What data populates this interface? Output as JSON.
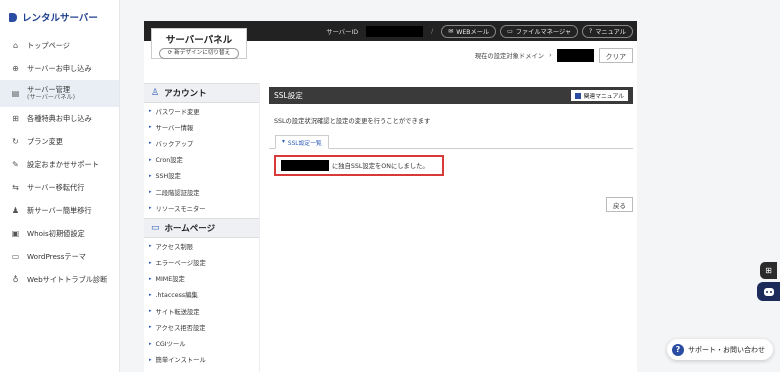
{
  "sidebar": {
    "logo": "レンタルサーバー",
    "items": [
      {
        "icon": "home-icon",
        "glyph": "⌂",
        "label": "トップページ"
      },
      {
        "icon": "plus-circle-icon",
        "glyph": "⊕",
        "label": "サーバーお申し込み"
      },
      {
        "icon": "server-icon",
        "glyph": "▤",
        "label": "サーバー管理",
        "sub": "(サーバーパネル)",
        "active": true
      },
      {
        "icon": "gift-icon",
        "glyph": "⊞",
        "label": "各種特典お申し込み"
      },
      {
        "icon": "refresh-icon",
        "glyph": "↻",
        "label": "プラン変更"
      },
      {
        "icon": "wrench-icon",
        "glyph": "✎",
        "label": "設定おまかせサポート"
      },
      {
        "icon": "migrate-icon",
        "glyph": "⇆",
        "label": "サーバー移転代行"
      },
      {
        "icon": "user-move-icon",
        "glyph": "♟",
        "label": "新サーバー簡単移行"
      },
      {
        "icon": "whois-icon",
        "glyph": "▣",
        "label": "Whois初期値設定"
      },
      {
        "icon": "wordpress-icon",
        "glyph": "▭",
        "label": "WordPressテーマ"
      },
      {
        "icon": "stethoscope-icon",
        "glyph": "♁",
        "label": "Webサイトトラブル診断"
      }
    ]
  },
  "topbar": {
    "server_id_label": "サーバーID",
    "sep": "/",
    "buttons": [
      {
        "icon": "mail-icon",
        "glyph": "✉",
        "label": "WEBメール"
      },
      {
        "icon": "folder-icon",
        "glyph": "▭",
        "label": "ファイルマネージャ"
      },
      {
        "icon": "help-icon",
        "glyph": "?",
        "label": "マニュアル"
      }
    ]
  },
  "panel": {
    "title": "サーバーパネル",
    "switch_label": "新デザインに切り替え",
    "domain_label": "現在の設定対象ドメイン",
    "clear": "クリア"
  },
  "menu": {
    "account_heading": "アカウント",
    "account_items": [
      "パスワード変更",
      "サーバー情報",
      "バックアップ",
      "Cron設定",
      "SSH設定",
      "二段階認証設定",
      "リソースモニター"
    ],
    "homepage_heading": "ホームページ",
    "homepage_items": [
      "アクセス制限",
      "エラーページ設定",
      "MIME設定",
      ".htaccess編集",
      "サイト転送設定",
      "アクセス拒否設定",
      "CGIツール",
      "簡単インストール"
    ]
  },
  "content": {
    "title": "SSL設定",
    "manual": "関連マニュアル",
    "description": "SSLの設定状況確認と設定の変更を行うことができます",
    "tab": "SSL設定一覧",
    "message": "に独自SSL設定をONにしました。",
    "back": "戻る"
  },
  "widgets": {
    "support": "サポート・お問い合わせ"
  }
}
